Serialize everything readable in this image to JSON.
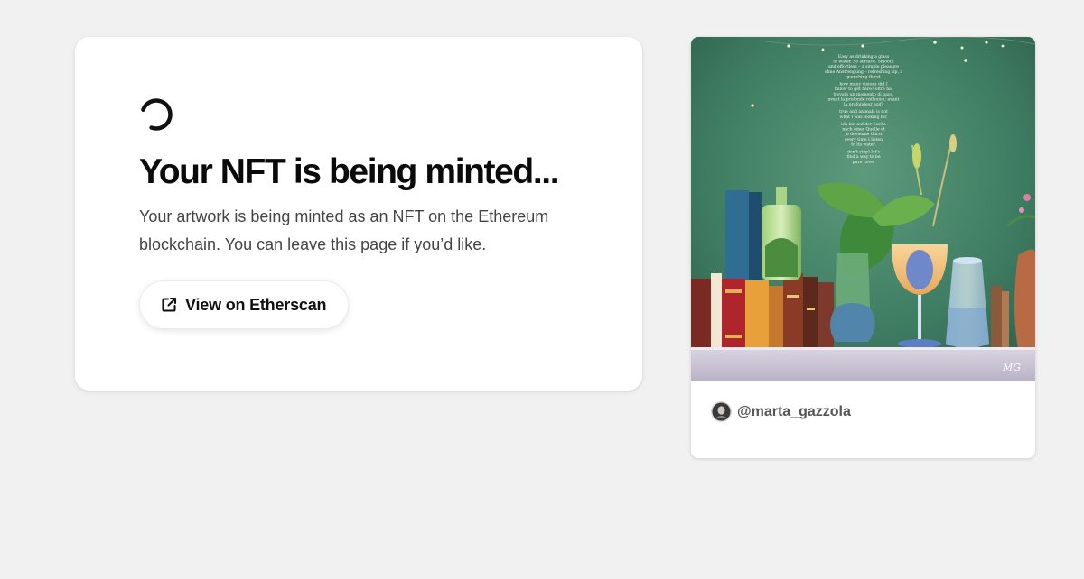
{
  "status": {
    "title": "Your NFT is being minted...",
    "description": "Your artwork is being minted as an NFT on the Ethereum blockchain. You can leave this page if you’d like.",
    "etherscan_label": "View on Etherscan",
    "spinner_icon": "loading-spinner-icon",
    "external_icon": "external-link-icon"
  },
  "artwork": {
    "artist_handle": "@marta_gazzola",
    "poem_lines": [
      "Easy as drinking a glass",
      "of water. So surface. Smooth",
      "and effortless – a simple pleasure",
      "ohne Anstrengung – refreshing sip, a",
      "quenching thirst.",
      "",
      "how many visions did I",
      "follow to get here? oltre hai",
      "trovato un momento di pace,",
      "avant la profonde réflexion; avant",
      "la profondeur soif?",
      "",
      "true and animals is not",
      "what I was looking for.",
      "",
      "ich bin auf der Suche",
      "nach einer Quelle et",
      "je devienne thirst",
      "every time I listen",
      "to its water.",
      "",
      "don't stop! let's",
      "find a way to be",
      "pure Love."
    ],
    "signature": "MG"
  },
  "colors": {
    "background": "#f1f1f1",
    "card": "#ffffff",
    "title": "#0a0a0a",
    "body_text": "#444444",
    "handle_text": "#555555"
  }
}
